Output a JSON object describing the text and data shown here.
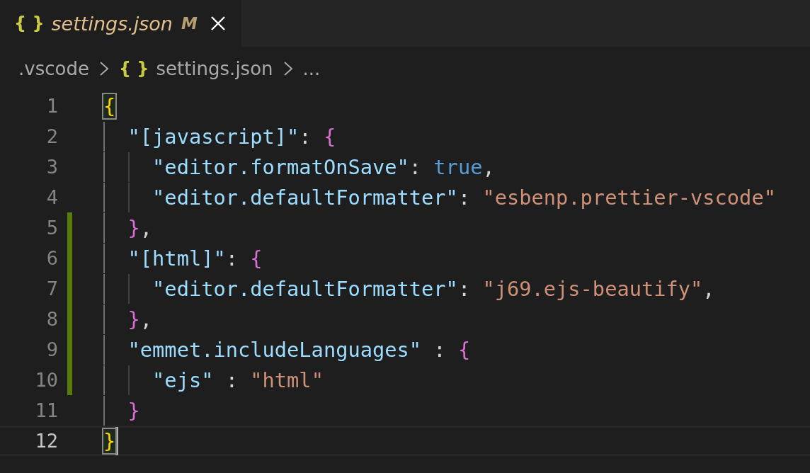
{
  "tabs": [
    {
      "icon": "{ }",
      "label": "settings.json",
      "badge": "M",
      "modified": true,
      "selected": true
    }
  ],
  "breadcrumbs": [
    {
      "label": ".vscode"
    },
    {
      "icon": "{ }",
      "label": "settings.json"
    },
    {
      "label": "..."
    }
  ],
  "lines": [
    {
      "number": "1",
      "modified": false,
      "current": false,
      "tokens": [
        {
          "kind": "bracket1",
          "text": "{",
          "matched": true
        }
      ]
    },
    {
      "number": "2",
      "modified": false,
      "current": false,
      "tokens": [
        {
          "kind": "key",
          "text": "  \"[javascript]\""
        },
        {
          "kind": "punct",
          "text": ": "
        },
        {
          "kind": "bracket2",
          "text": "{",
          "matched": false
        }
      ]
    },
    {
      "number": "3",
      "modified": false,
      "current": false,
      "tokens": [
        {
          "kind": "key",
          "text": "    \"editor.formatOnSave\""
        },
        {
          "kind": "punct",
          "text": ": "
        },
        {
          "kind": "bool",
          "text": "true"
        },
        {
          "kind": "punct",
          "text": ","
        }
      ]
    },
    {
      "number": "4",
      "modified": false,
      "current": false,
      "tokens": [
        {
          "kind": "key",
          "text": "    \"editor.defaultFormatter\""
        },
        {
          "kind": "punct",
          "text": ": "
        },
        {
          "kind": "string",
          "text": "\"esbenp.prettier-vscode\""
        }
      ]
    },
    {
      "number": "5",
      "modified": true,
      "current": false,
      "tokens": [
        {
          "kind": "bracket2",
          "text": "  }",
          "matched": false
        },
        {
          "kind": "punct",
          "text": ","
        }
      ]
    },
    {
      "number": "6",
      "modified": true,
      "current": false,
      "tokens": [
        {
          "kind": "key",
          "text": "  \"[html]\""
        },
        {
          "kind": "punct",
          "text": ": "
        },
        {
          "kind": "bracket2",
          "text": "{",
          "matched": false
        }
      ]
    },
    {
      "number": "7",
      "modified": true,
      "current": false,
      "tokens": [
        {
          "kind": "key",
          "text": "    \"editor.defaultFormatter\""
        },
        {
          "kind": "punct",
          "text": ": "
        },
        {
          "kind": "string",
          "text": "\"j69.ejs-beautify\""
        },
        {
          "kind": "punct",
          "text": ","
        }
      ]
    },
    {
      "number": "8",
      "modified": true,
      "current": false,
      "tokens": [
        {
          "kind": "bracket2",
          "text": "  }",
          "matched": false
        },
        {
          "kind": "punct",
          "text": ","
        }
      ]
    },
    {
      "number": "9",
      "modified": true,
      "current": false,
      "tokens": [
        {
          "kind": "key",
          "text": "  \"emmet.includeLanguages\""
        },
        {
          "kind": "punct",
          "text": " : "
        },
        {
          "kind": "bracket2",
          "text": "{",
          "matched": false
        }
      ]
    },
    {
      "number": "10",
      "modified": true,
      "current": false,
      "tokens": [
        {
          "kind": "key",
          "text": "    \"ejs\""
        },
        {
          "kind": "punct",
          "text": " : "
        },
        {
          "kind": "string",
          "text": "\"html\""
        }
      ]
    },
    {
      "number": "11",
      "modified": false,
      "current": false,
      "tokens": [
        {
          "kind": "bracket2",
          "text": "  }",
          "matched": false
        }
      ]
    },
    {
      "number": "12",
      "modified": false,
      "current": true,
      "tokens": [
        {
          "kind": "bracket1",
          "text": "}",
          "matched": true
        }
      ]
    }
  ]
}
